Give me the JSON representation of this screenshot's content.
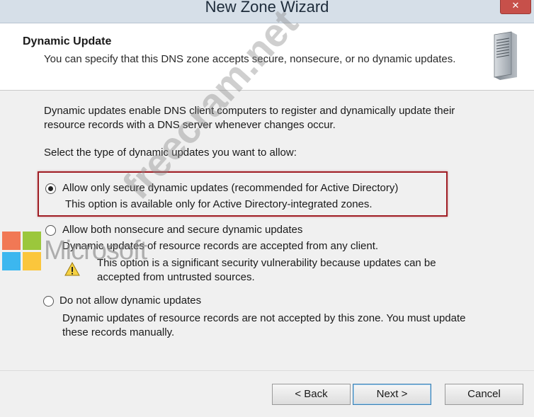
{
  "window": {
    "title": "New Zone Wizard",
    "close_glyph": "✕"
  },
  "header": {
    "title": "Dynamic Update",
    "description": "You can specify that this DNS zone accepts secure, nonsecure, or no dynamic updates.",
    "icon": "server-icon"
  },
  "body": {
    "intro_line1": "Dynamic updates enable DNS client computers to register and dynamically update their",
    "intro_line2": "resource records with a DNS server whenever changes occur.",
    "select_prompt": "Select the type of dynamic updates you want to allow:",
    "options": [
      {
        "label": "Allow only secure dynamic updates (recommended for Active Directory)",
        "description": "This option is available only for Active Directory-integrated zones.",
        "selected": true
      },
      {
        "label": "Allow both nonsecure and secure dynamic updates",
        "description": "Dynamic updates of resource records are accepted from any client.",
        "warning_line1": "This option is a significant security vulnerability because updates can be",
        "warning_line2": "accepted from untrusted sources.",
        "selected": false
      },
      {
        "label": "Do not allow dynamic updates",
        "description_line1": "Dynamic updates of resource records are not accepted by this zone. You must update",
        "description_line2": "these records manually.",
        "selected": false
      }
    ]
  },
  "footer": {
    "back_label": "< Back",
    "next_label": "Next >",
    "cancel_label": "Cancel"
  },
  "watermark": {
    "brand": "Microsoft",
    "site": "freecram.net"
  },
  "colors": {
    "highlight_border": "#a01e25",
    "titlebar": "#d6dfe8",
    "body_bg": "#f0f0f0"
  }
}
